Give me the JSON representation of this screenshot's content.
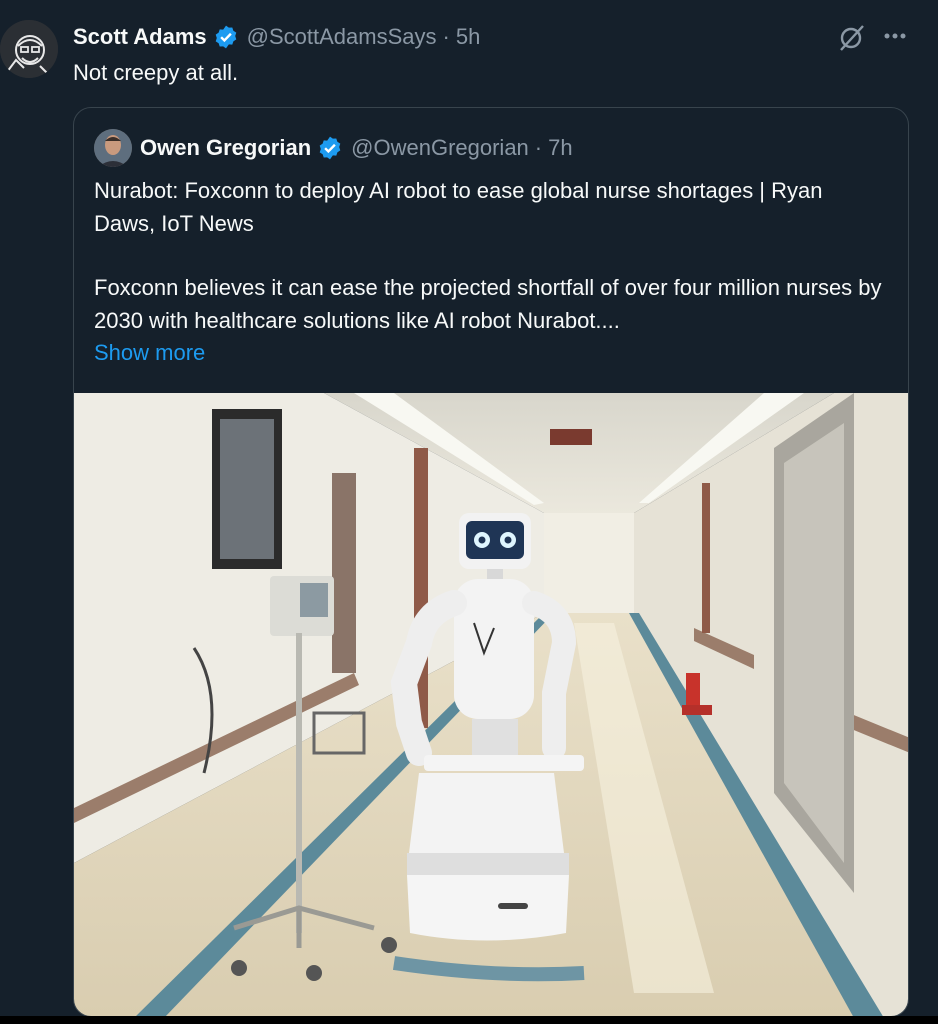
{
  "tweet": {
    "author_name": "Scott Adams",
    "handle": "@ScottAdamsSays",
    "separator": "·",
    "time": "5h",
    "text": "Not creepy at all."
  },
  "quoted": {
    "author_name": "Owen Gregorian",
    "handle": "@OwenGregorian",
    "separator": "·",
    "time": "7h",
    "headline": "Nurabot: Foxconn to deploy AI robot to ease global nurse shortages | Ryan Daws, IoT News",
    "body": "Foxconn believes it can ease the projected shortfall of over four million nurses by 2030 with healthcare solutions like AI robot Nurabot....",
    "show_more": "Show more"
  },
  "icons": {
    "verified": "verified-badge-icon",
    "grok": "grok-icon",
    "more": "more-icon"
  },
  "colors": {
    "background": "#15202b",
    "accent": "#1d9bf0",
    "secondary_text": "#8b98a5",
    "border": "#38444d"
  }
}
